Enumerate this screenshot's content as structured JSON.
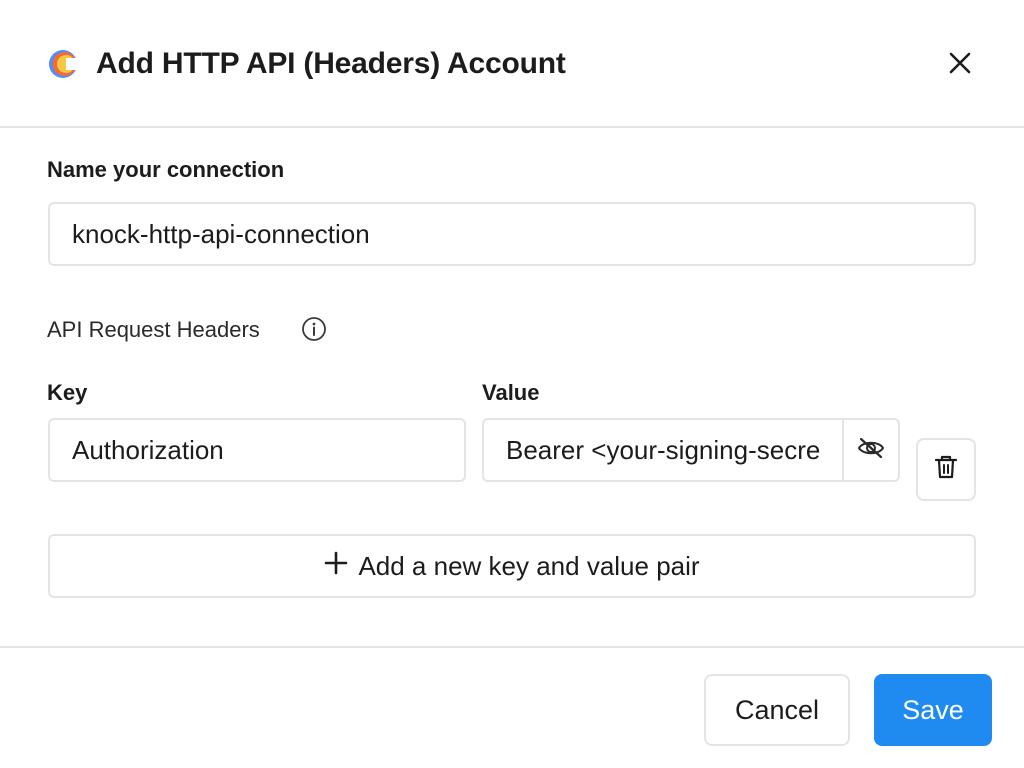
{
  "dialog": {
    "title": "Add HTTP API (Headers) Account",
    "logo_icon": "knock-logo",
    "close_icon": "close-icon"
  },
  "connection": {
    "label": "Name your connection",
    "value": "knock-http-api-connection"
  },
  "headers": {
    "section_label": "API Request Headers",
    "info_icon": "info-icon",
    "key_label": "Key",
    "value_label": "Value",
    "rows": [
      {
        "key": "Authorization",
        "value": "Bearer <your-signing-secret>",
        "visibility_icon": "eye-off-icon",
        "delete_icon": "trash-icon"
      }
    ],
    "add_pair_label": "Add a new key and value pair",
    "add_icon": "plus-icon"
  },
  "footer": {
    "cancel_label": "Cancel",
    "save_label": "Save"
  },
  "colors": {
    "accent": "#1f8bf1",
    "border": "#e4e4e7",
    "text": "#1c1c1c",
    "logo_orange": "#f36b3b",
    "logo_yellow": "#f7c744",
    "logo_blue": "#4f8ff7"
  }
}
